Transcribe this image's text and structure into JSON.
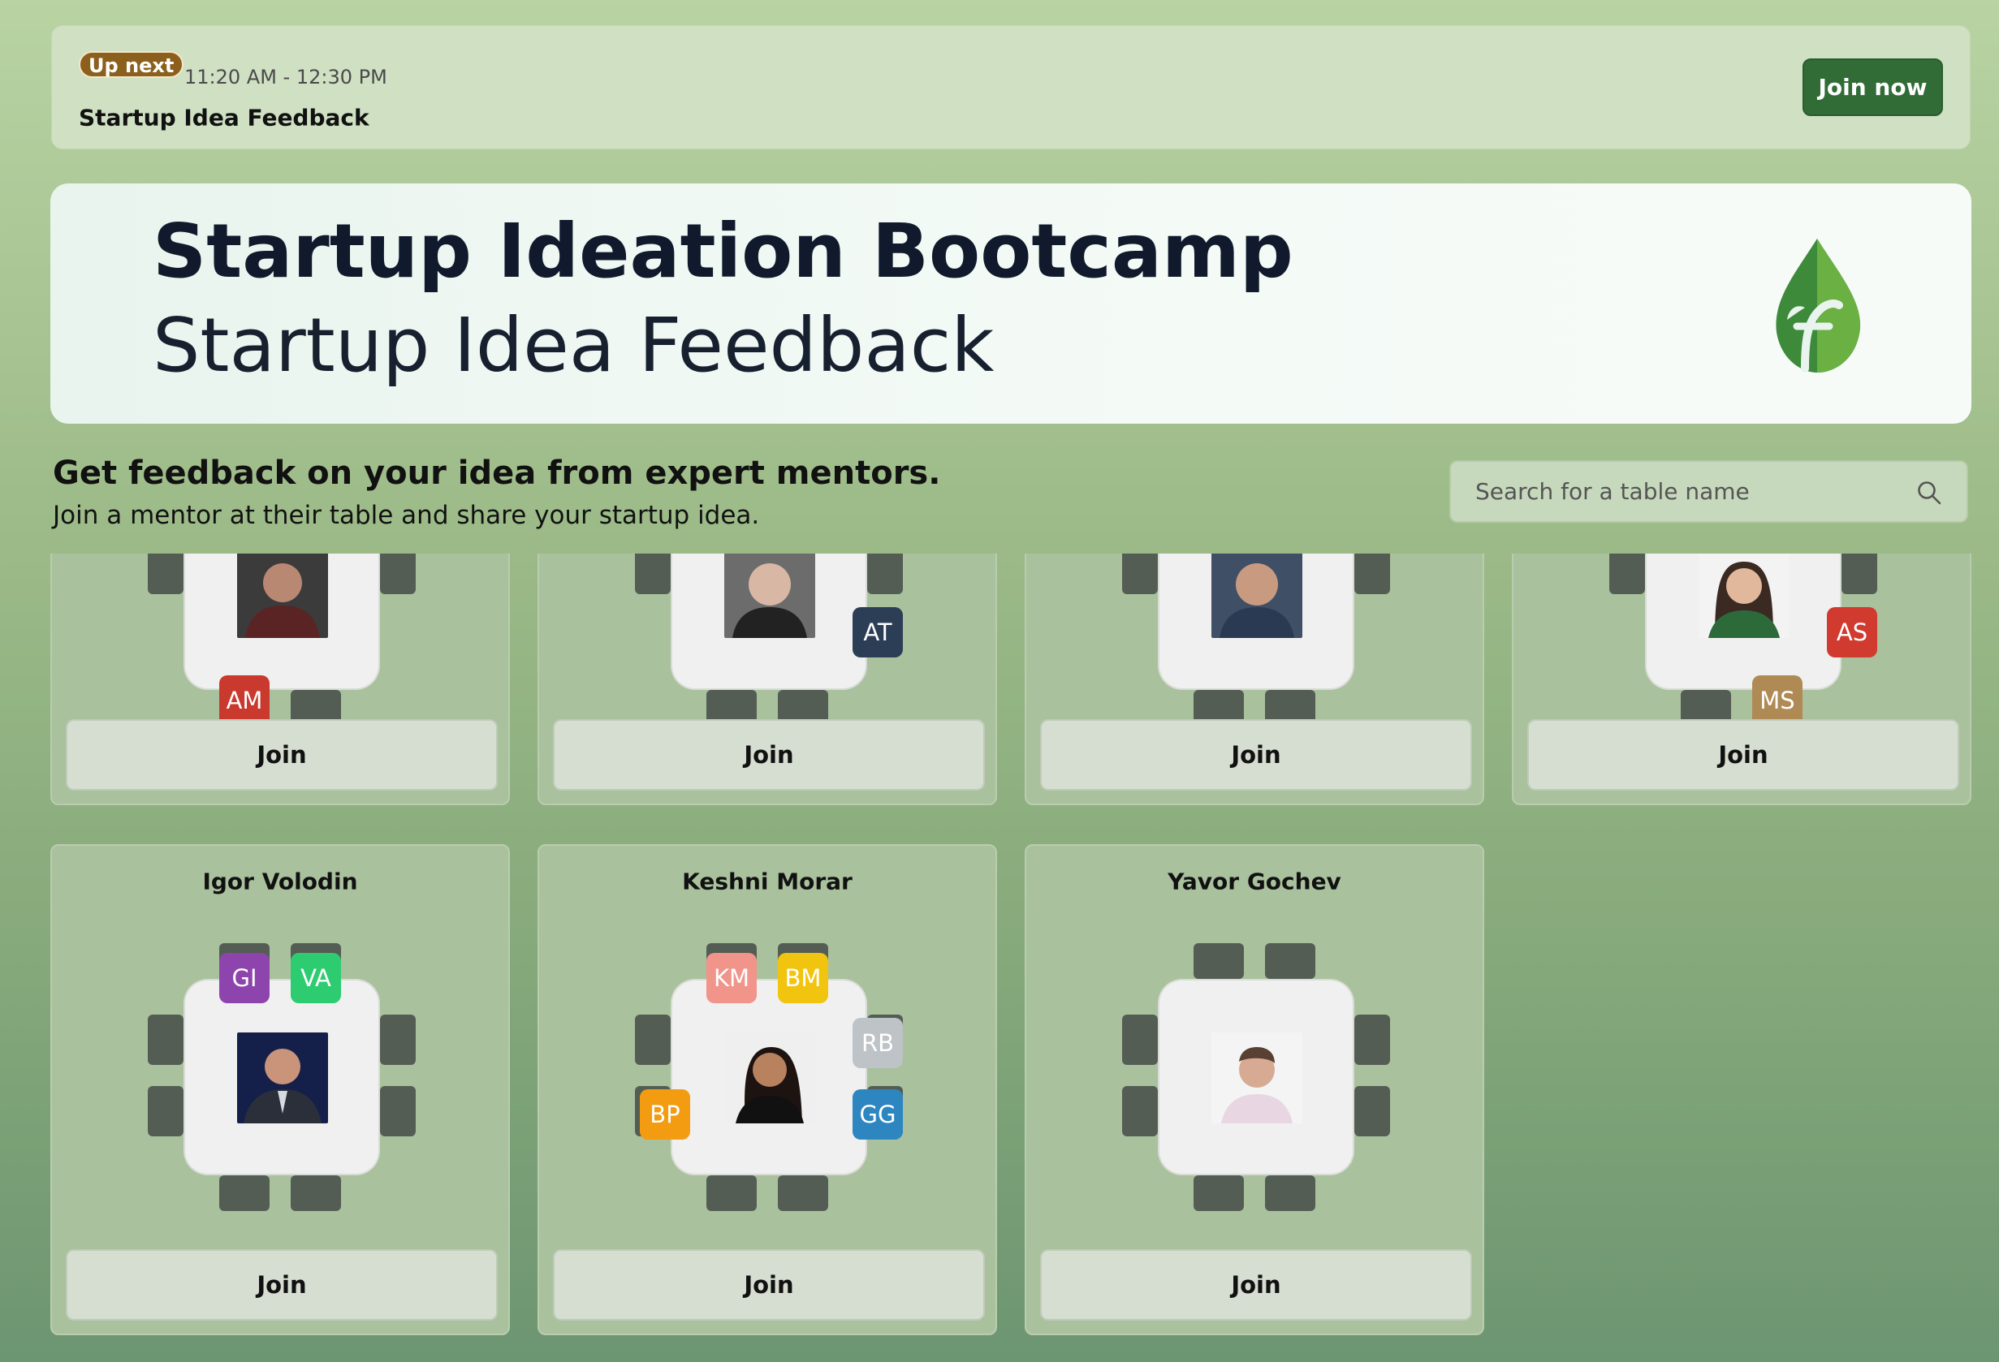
{
  "up_next": {
    "badge": "Up next",
    "time": "11:20 AM - 12:30 PM",
    "title": "Startup Idea Feedback",
    "join_label": "Join now"
  },
  "banner": {
    "title": "Startup Ideation Bootcamp",
    "subtitle": "Startup Idea Feedback",
    "logo_icon": "leaf-f-logo"
  },
  "intro": {
    "heading": "Get feedback on your idea from expert mentors.",
    "subheading": "Join a mentor at their table and share your startup idea."
  },
  "search": {
    "placeholder": "Search for a table name",
    "icon": "search-icon"
  },
  "colors": {
    "accent": "#316c36",
    "badge": "#8c5f1c"
  },
  "tables": [
    {
      "name": "",
      "join_label": "Join",
      "avatars": [
        {
          "initials": "AM",
          "color": "#c9392e"
        }
      ]
    },
    {
      "name": "",
      "join_label": "Join",
      "avatars": [
        {
          "initials": "AT",
          "color": "#2c3e55"
        }
      ]
    },
    {
      "name": "",
      "join_label": "Join",
      "avatars": []
    },
    {
      "name": "",
      "join_label": "Join",
      "avatars": [
        {
          "initials": "AS",
          "color": "#d03a2f"
        },
        {
          "initials": "MS",
          "color": "#b08a55"
        }
      ]
    },
    {
      "name": "Igor Volodin",
      "join_label": "Join",
      "avatars": [
        {
          "initials": "GI",
          "color": "#8e44ad"
        },
        {
          "initials": "VA",
          "color": "#2ecc71"
        }
      ]
    },
    {
      "name": "Keshni Morar",
      "join_label": "Join",
      "avatars": [
        {
          "initials": "KM",
          "color": "#f1948a"
        },
        {
          "initials": "BM",
          "color": "#f1c40f"
        },
        {
          "initials": "RB",
          "color": "#bdc3c7"
        },
        {
          "initials": "BP",
          "color": "#f39c12"
        },
        {
          "initials": "GG",
          "color": "#2e86c1"
        }
      ]
    },
    {
      "name": "Yavor Gochev",
      "join_label": "Join",
      "avatars": []
    }
  ]
}
